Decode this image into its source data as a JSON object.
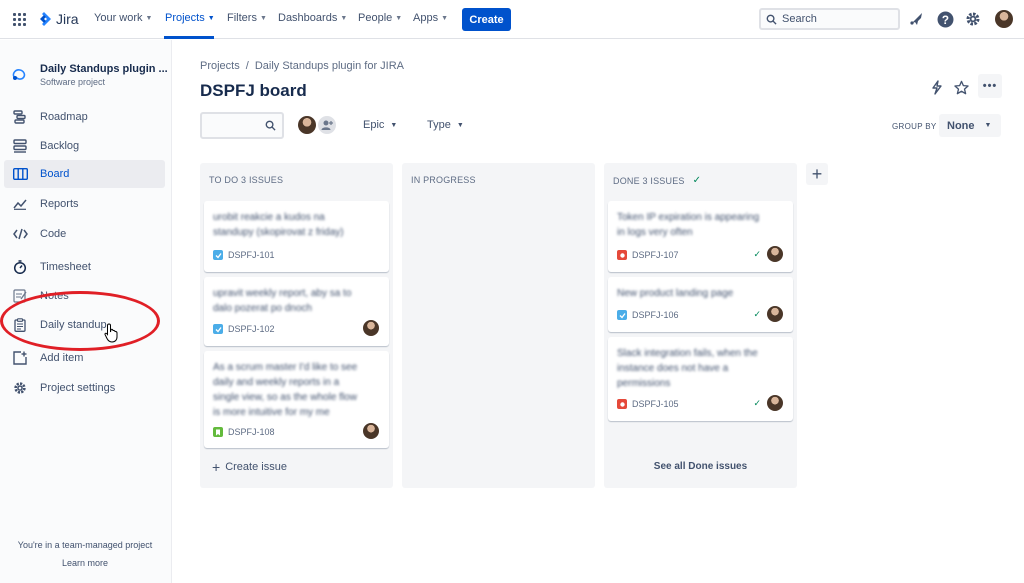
{
  "topnav": {
    "logo": "Jira",
    "items": [
      {
        "label": "Your work"
      },
      {
        "label": "Projects"
      },
      {
        "label": "Filters"
      },
      {
        "label": "Dashboards"
      },
      {
        "label": "People"
      },
      {
        "label": "Apps"
      }
    ],
    "create_label": "Create",
    "search_placeholder": "Search",
    "accent": "#0052cc"
  },
  "sidebar": {
    "project_name": "Daily Standups plugin ...",
    "project_type": "Software project",
    "items": [
      {
        "label": "Roadmap",
        "icon": "roadmap-icon"
      },
      {
        "label": "Backlog",
        "icon": "backlog-icon"
      },
      {
        "label": "Board",
        "icon": "board-icon"
      },
      {
        "label": "Reports",
        "icon": "reports-icon"
      },
      {
        "label": "Code",
        "icon": "code-icon"
      },
      {
        "label": "Timesheet",
        "icon": "timer-icon"
      },
      {
        "label": "Notes",
        "icon": "notes-icon"
      },
      {
        "label": "Daily standup",
        "icon": "clipboard-icon"
      },
      {
        "label": "Add item",
        "icon": "add-item-icon"
      },
      {
        "label": "Project settings",
        "icon": "gear-icon"
      }
    ],
    "footer_text": "You're in a team-managed project",
    "footer_link": "Learn more"
  },
  "main": {
    "breadcrumb": [
      "Projects",
      "Daily Standups plugin for JIRA"
    ],
    "title": "DSPFJ board",
    "filters": {
      "epic": "Epic",
      "type": "Type"
    },
    "group_by_label": "GROUP BY",
    "group_by_value": "None"
  },
  "columns": [
    {
      "title": "TO DO 3 ISSUES",
      "cards": [
        {
          "summary": "urobit reakcie a kudos na standupy (skopirovat z friday)",
          "key": "DSPFJ-101",
          "type": "task"
        },
        {
          "summary": "upravit weekly report, aby sa to dalo pozerat po dnoch",
          "key": "DSPFJ-102",
          "type": "task"
        },
        {
          "summary": "As a scrum master I'd like to see daily and weekly reports in a single view, so as the whole flow is more intuitive for my me",
          "key": "DSPFJ-108",
          "type": "story"
        }
      ],
      "footer": "Create issue"
    },
    {
      "title": "IN PROGRESS",
      "cards": []
    },
    {
      "title": "DONE 3 ISSUES",
      "cards": [
        {
          "summary": "Token IP expiration is appearing in logs very often",
          "key": "DSPFJ-107",
          "type": "bug"
        },
        {
          "summary": "New product landing page",
          "key": "DSPFJ-106",
          "type": "task"
        },
        {
          "summary": "Slack integration fails, when the instance does not have a permissions",
          "key": "DSPFJ-105",
          "type": "bug"
        }
      ],
      "footer": "See all Done issues"
    }
  ],
  "colors": {
    "task": "#4bade8",
    "story": "#63ba3c",
    "bug": "#e5493a",
    "done_check": "#00875a",
    "annotation": "#e01f26"
  }
}
